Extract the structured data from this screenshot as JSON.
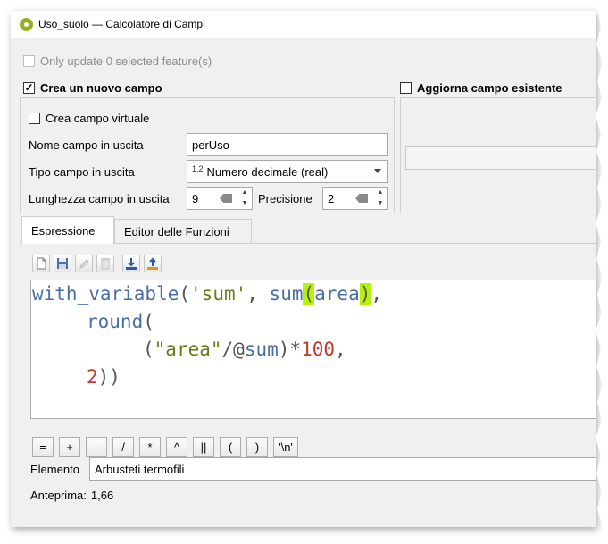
{
  "window": {
    "title": "Uso_suolo — Calcolatore di Campi"
  },
  "top": {
    "only_update_label": "Only update 0 selected feature(s)",
    "only_update_checked": false
  },
  "create_group": {
    "checkbox_label": "Crea un nuovo campo",
    "checked": true,
    "virtual_label": "Crea campo virtuale",
    "virtual_checked": false,
    "name_label": "Nome campo in uscita",
    "name_value": "perUso",
    "type_label": "Tipo campo in uscita",
    "type_icon": "1.2",
    "type_value": "Numero decimale (real)",
    "length_label": "Lunghezza campo in uscita",
    "length_value": "9",
    "precision_label": "Precisione",
    "precision_value": "2"
  },
  "update_group": {
    "checkbox_label": "Aggiorna campo esistente",
    "checked": false
  },
  "tabs": [
    {
      "label": "Espressione",
      "active": true
    },
    {
      "label": "Editor delle Funzioni",
      "active": false
    }
  ],
  "toolbar_icons": [
    "new-file-icon",
    "save-icon",
    "edit-icon",
    "delete-icon",
    "load-icon",
    "export-icon"
  ],
  "expression": {
    "l1_fn": "with_variable",
    "l1_open": "(",
    "l1_str": "'sum'",
    "l1_comma": ", ",
    "l1_fn2": "sum",
    "l1_p1": "(",
    "l1_arg": "area",
    "l1_p2": ")",
    "l1_end": ",",
    "l2_fn": "round",
    "l2_open": "(",
    "l3_open": "(",
    "l3_field": "\"area\"",
    "l3_div": "/",
    "l3_at": "@",
    "l3_var": "sum",
    "l3_close": ")",
    "l3_mul": "*",
    "l3_num": "100",
    "l3_comma": ",",
    "l4_num": "2",
    "l4_close": "))"
  },
  "operators": [
    "=",
    "+",
    "-",
    "/",
    "*",
    "^",
    "||",
    "(",
    ")",
    "'\\n'"
  ],
  "element": {
    "label": "Elemento",
    "value": "Arbusteti termofili"
  },
  "preview": {
    "label": "Anteprima:",
    "value": "1,66"
  },
  "colors": {
    "highlight": "#b5f20a",
    "function_blue": "#4a6fa5",
    "string_green": "#2e7d32",
    "number_red": "#c0392b"
  }
}
